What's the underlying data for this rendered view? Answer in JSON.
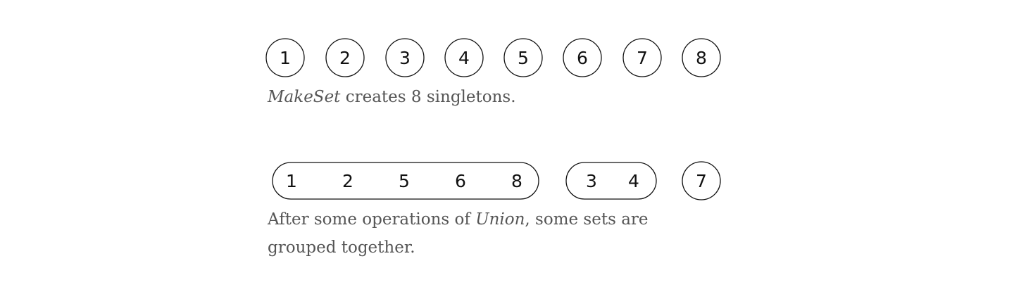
{
  "diagram_1": {
    "nodes": [
      "1",
      "2",
      "3",
      "4",
      "5",
      "6",
      "7",
      "8"
    ],
    "caption": {
      "term": "MakeSet",
      "rest": " creates 8 singletons."
    }
  },
  "diagram_2": {
    "groups": [
      [
        "1",
        "2",
        "5",
        "6",
        "8"
      ],
      [
        "3",
        "4"
      ],
      [
        "7"
      ]
    ],
    "caption": {
      "before": "After some operations of ",
      "term": "Union",
      "after": ", some sets are grouped together."
    }
  }
}
